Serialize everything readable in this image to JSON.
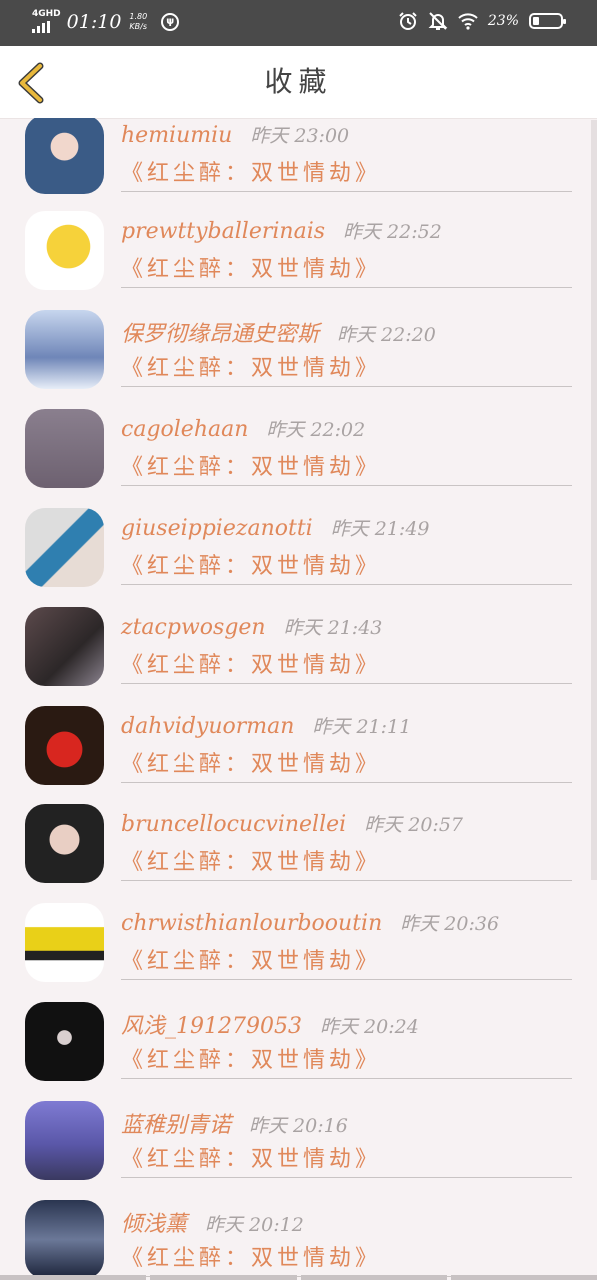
{
  "status_bar": {
    "network": "4GHD",
    "time": "01:10",
    "speed_value": "1.80",
    "speed_unit": "KB/s",
    "battery_percent": "23%",
    "battery_level": 0.23,
    "icons": [
      "signal-icon",
      "app-notification-icon",
      "alarm-icon",
      "mute-icon",
      "wifi-icon",
      "battery-icon"
    ]
  },
  "header": {
    "title": "收藏",
    "back_icon": "chevron-left-icon"
  },
  "colors": {
    "accent": "#e0885a",
    "timestamp": "#a9a3a3",
    "background": "#f7f2f3",
    "status_bar": "#4a4a4a",
    "back_icon": "#e8b83c"
  },
  "favorites": [
    {
      "username": "hemiumiu",
      "time": "昨天 23:00",
      "book": "《红尘醉：双世情劫》"
    },
    {
      "username": "prewttyballerinais",
      "time": "昨天 22:52",
      "book": "《红尘醉：双世情劫》"
    },
    {
      "username": "保罗彻缘昂通史密斯",
      "time": "昨天 22:20",
      "book": "《红尘醉：双世情劫》"
    },
    {
      "username": "cagolehaan",
      "time": "昨天 22:02",
      "book": "《红尘醉：双世情劫》"
    },
    {
      "username": "giuseippiezanotti",
      "time": "昨天 21:49",
      "book": "《红尘醉：双世情劫》"
    },
    {
      "username": "ztacpwosgen",
      "time": "昨天 21:43",
      "book": "《红尘醉：双世情劫》"
    },
    {
      "username": "dahvidyuorman",
      "time": "昨天 21:11",
      "book": "《红尘醉：双世情劫》"
    },
    {
      "username": "bruncellocucvinellei",
      "time": "昨天 20:57",
      "book": "《红尘醉：双世情劫》"
    },
    {
      "username": "chrwisthianlourbooutin",
      "time": "昨天 20:36",
      "book": "《红尘醉：双世情劫》"
    },
    {
      "username": "风浅_191279053",
      "time": "昨天 20:24",
      "book": "《红尘醉：双世情劫》"
    },
    {
      "username": "蓝稚别青诺",
      "time": "昨天 20:16",
      "book": "《红尘醉：双世情劫》"
    },
    {
      "username": "倾浅薰",
      "time": "昨天 20:12",
      "book": "《红尘醉：双世情劫》"
    }
  ]
}
